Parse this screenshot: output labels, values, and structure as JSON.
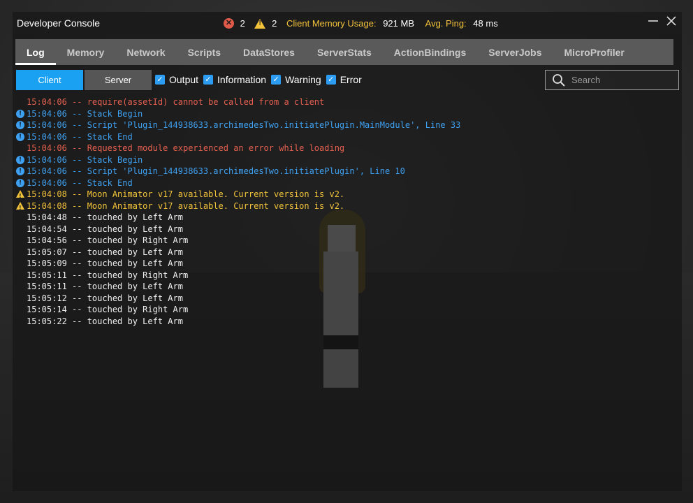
{
  "window": {
    "title": "Developer Console"
  },
  "stats": {
    "error_count": "2",
    "warning_count": "2",
    "memory_label": "Client Memory Usage:",
    "memory_value": "921 MB",
    "ping_label": "Avg. Ping:",
    "ping_value": "48 ms"
  },
  "tabs": [
    {
      "label": "Log",
      "active": true
    },
    {
      "label": "Memory"
    },
    {
      "label": "Network"
    },
    {
      "label": "Scripts"
    },
    {
      "label": "DataStores"
    },
    {
      "label": "ServerStats"
    },
    {
      "label": "ActionBindings"
    },
    {
      "label": "ServerJobs"
    },
    {
      "label": "MicroProfiler"
    }
  ],
  "toolbar": {
    "client_label": "Client",
    "server_label": "Server",
    "filters": [
      {
        "label": "Output",
        "checked": true
      },
      {
        "label": "Information",
        "checked": true
      },
      {
        "label": "Warning",
        "checked": true
      },
      {
        "label": "Error",
        "checked": true
      }
    ],
    "search_placeholder": "Search"
  },
  "log": [
    {
      "level": "error",
      "text": "15:04:06 -- require(assetId) cannot be called from a client"
    },
    {
      "level": "info",
      "text": "15:04:06 -- Stack Begin"
    },
    {
      "level": "info",
      "text": "15:04:06 -- Script 'Plugin_144938633.archimedesTwo.initiatePlugin.MainModule', Line 33"
    },
    {
      "level": "info",
      "text": "15:04:06 -- Stack End"
    },
    {
      "level": "error",
      "text": "15:04:06 -- Requested module experienced an error while loading"
    },
    {
      "level": "info",
      "text": "15:04:06 -- Stack Begin"
    },
    {
      "level": "info",
      "text": "15:04:06 -- Script 'Plugin_144938633.archimedesTwo.initiatePlugin', Line 10"
    },
    {
      "level": "info",
      "text": "15:04:06 -- Stack End"
    },
    {
      "level": "warning",
      "text": "15:04:08 -- Moon Animator v17 available. Current version is v2."
    },
    {
      "level": "warning",
      "text": "15:04:08 -- Moon Animator v17 available. Current version is v2."
    },
    {
      "level": "output",
      "text": "15:04:48 -- touched by Left Arm"
    },
    {
      "level": "output",
      "text": "15:04:54 -- touched by Left Arm"
    },
    {
      "level": "output",
      "text": "15:04:56 -- touched by Right Arm"
    },
    {
      "level": "output",
      "text": "15:05:07 -- touched by Left Arm"
    },
    {
      "level": "output",
      "text": "15:05:09 -- touched by Left Arm"
    },
    {
      "level": "output",
      "text": "15:05:11 -- touched by Right Arm"
    },
    {
      "level": "output",
      "text": "15:05:11 -- touched by Left Arm"
    },
    {
      "level": "output",
      "text": "15:05:12 -- touched by Left Arm"
    },
    {
      "level": "output",
      "text": "15:05:14 -- touched by Right Arm"
    },
    {
      "level": "output",
      "text": "15:05:22 -- touched by Left Arm"
    }
  ],
  "colors": {
    "accent": "#1ba1f2",
    "error": "#e5604f",
    "info": "#3ea0f0",
    "warning": "#f2c23a",
    "output": "#f0f0f0"
  },
  "icons": {
    "error": "error-circle-icon",
    "warning": "warning-triangle-icon",
    "info": "info-circle-icon",
    "search": "search-icon",
    "minimize": "minimize-icon",
    "close": "close-icon",
    "checkbox": "checkbox-checked-icon"
  }
}
